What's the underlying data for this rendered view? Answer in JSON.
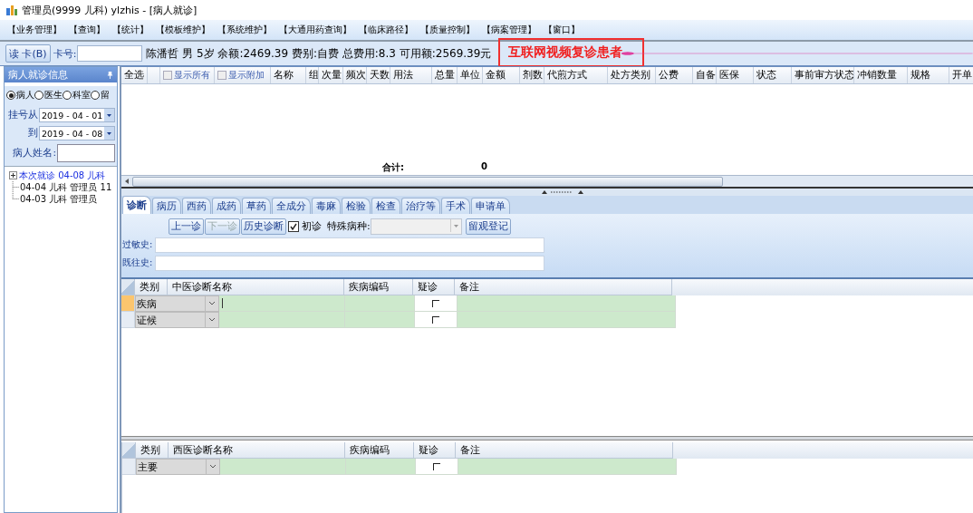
{
  "window": {
    "title": "管理员(9999 儿科) ylzhis - [病人就诊]"
  },
  "menu": [
    "【业务管理】",
    "【查询】",
    "【统计】",
    "【模板维护】",
    "【系统维护】",
    "【大通用药查询】",
    "【临床路径】",
    "【质量控制】",
    "【病案管理】",
    "【窗口】"
  ],
  "patient_bar": {
    "read_card_button": "读 卡(B)",
    "card_label": "卡号:",
    "info": "陈潘哲 男 5岁 余额:2469.39 费别:自费 总费用:8.3 可用额:2569.39元",
    "alert": "互联网视频复诊患者"
  },
  "left_panel": {
    "title": "病人就诊信息",
    "radios": [
      {
        "label": "病人",
        "selected": true
      },
      {
        "label": "医生",
        "selected": false
      },
      {
        "label": "科室",
        "selected": false
      },
      {
        "label": "留",
        "selected": false
      }
    ],
    "date_from": {
      "label": "挂号从",
      "value": "2019 - 04 - 01"
    },
    "date_to": {
      "label": "到",
      "value": "2019 - 04 - 08"
    },
    "name_field": {
      "label": "病人姓名:"
    },
    "tree": [
      {
        "label": "本次就诊 04-08 儿科",
        "kind": "group"
      },
      {
        "label": "04-04 儿科 管理员 11",
        "kind": "visit"
      },
      {
        "label": "04-03 儿科 管理员",
        "kind": "visit"
      }
    ]
  },
  "order_grid": {
    "columns": [
      {
        "label": "全选",
        "kind": "text"
      },
      {
        "kind": "blank"
      },
      {
        "label": "显示所有",
        "kind": "checkbox",
        "checked": false
      },
      {
        "label": "显示附加",
        "kind": "checkbox",
        "checked": false
      },
      {
        "label": "名称",
        "kind": "text"
      },
      {
        "label": "组",
        "kind": "text"
      },
      {
        "label": "次量",
        "kind": "text"
      },
      {
        "label": "频次",
        "kind": "text"
      },
      {
        "label": "天数",
        "kind": "text"
      },
      {
        "label": "用法",
        "kind": "text"
      },
      {
        "label": "总量",
        "kind": "text"
      },
      {
        "label": "单位",
        "kind": "text"
      },
      {
        "label": "金额",
        "kind": "text"
      },
      {
        "label": "剂数",
        "kind": "text"
      },
      {
        "label": "代煎方式",
        "kind": "text"
      },
      {
        "label": "处方类别",
        "kind": "text"
      },
      {
        "label": "公费",
        "kind": "text"
      },
      {
        "label": "自备",
        "kind": "text"
      },
      {
        "label": "医保",
        "kind": "text"
      },
      {
        "label": "状态",
        "kind": "text"
      },
      {
        "label": "事前审方状态",
        "kind": "text"
      },
      {
        "label": "冲销数量",
        "kind": "text"
      },
      {
        "label": "规格",
        "kind": "text"
      },
      {
        "label": "开单",
        "kind": "text"
      }
    ],
    "total_label": "合计:",
    "total_value": "0"
  },
  "tabs": [
    {
      "label": "诊断",
      "selected": true
    },
    {
      "label": "病历",
      "selected": false
    },
    {
      "label": "西药",
      "selected": false
    },
    {
      "label": "成药",
      "selected": false
    },
    {
      "label": "草药",
      "selected": false
    },
    {
      "label": "全成分",
      "selected": false
    },
    {
      "label": "毒麻",
      "selected": false
    },
    {
      "label": "检验",
      "selected": false
    },
    {
      "label": "检查",
      "selected": false
    },
    {
      "label": "治疗等",
      "selected": false
    },
    {
      "label": "手术",
      "selected": false
    },
    {
      "label": "申请单",
      "selected": false
    }
  ],
  "toolbar": {
    "buttons": [
      {
        "label": "上一诊",
        "disabled": false
      },
      {
        "label": "下一诊",
        "disabled": true
      },
      {
        "label": "历史诊断",
        "disabled": false
      }
    ],
    "first_visit": {
      "label": "初诊",
      "checked": true
    },
    "special_disease_label": "特殊病种:",
    "observe_button": "留观登记"
  },
  "history_fields": [
    {
      "label": "过敏史:"
    },
    {
      "label": "既往史:"
    }
  ],
  "tcm_grid": {
    "columns": [
      "类别",
      "中医诊断名称",
      "疾病编码",
      "疑诊",
      "备注"
    ],
    "rows": [
      {
        "category": "疾病",
        "selected": true,
        "suspected": false
      },
      {
        "category": "证候",
        "selected": false,
        "suspected": false
      }
    ]
  },
  "western_grid": {
    "columns": [
      "类别",
      "西医诊断名称",
      "疾病编码",
      "疑诊",
      "备注"
    ],
    "rows": [
      {
        "category": "主要",
        "selected": false,
        "suspected": false
      }
    ]
  }
}
